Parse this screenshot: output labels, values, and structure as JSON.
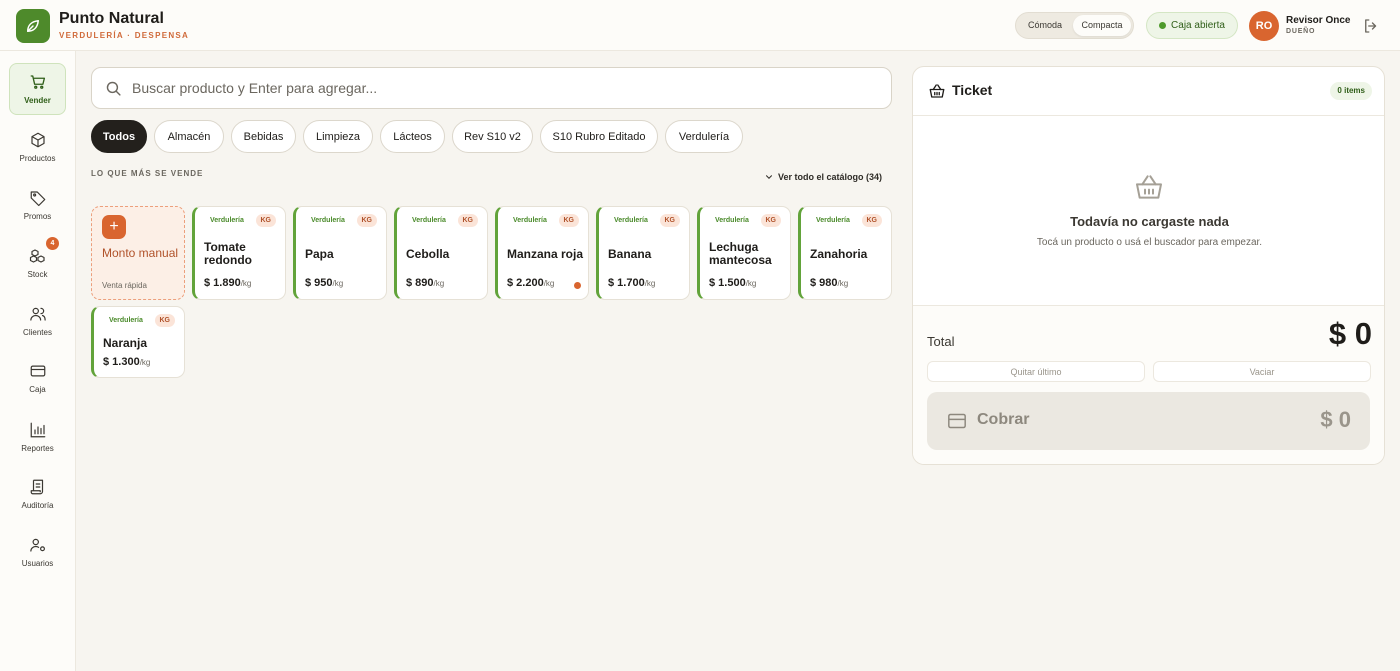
{
  "brand": {
    "name": "Punto Natural",
    "subtitle": "VERDULERÍA · DESPENSA"
  },
  "header": {
    "density": {
      "options": [
        "Cómoda",
        "Compacta"
      ],
      "selected": "Compacta"
    },
    "cash_status": "Caja abierta",
    "user": {
      "initials": "RO",
      "name": "Revisor Once",
      "role": "DUEÑO"
    }
  },
  "sidebar": {
    "items": [
      {
        "label": "Vender",
        "icon": "cart-icon",
        "active": true
      },
      {
        "label": "Productos",
        "icon": "box-icon"
      },
      {
        "label": "Promos",
        "icon": "tag-icon"
      },
      {
        "label": "Stock",
        "icon": "boxes-icon",
        "badge": "4"
      },
      {
        "label": "Clientes",
        "icon": "users-icon"
      },
      {
        "label": "Caja",
        "icon": "card-icon"
      },
      {
        "label": "Reportes",
        "icon": "bar-chart-icon"
      },
      {
        "label": "Auditoría",
        "icon": "scroll-icon"
      },
      {
        "label": "Usuarios",
        "icon": "user-cog-icon"
      }
    ]
  },
  "search": {
    "placeholder": "Buscar producto y Enter para agregar..."
  },
  "categories": [
    "Todos",
    "Almacén",
    "Bebidas",
    "Limpieza",
    "Lácteos",
    "Rev S10 v2",
    "S10 Rubro Editado",
    "Verdulería"
  ],
  "active_category": "Todos",
  "section": {
    "title": "LO QUE MÁS SE VENDE",
    "see_all": "Ver todo el catálogo (34)"
  },
  "manual_entry": {
    "title": "Monto manual",
    "subtitle": "Venta rápida",
    "icon": "plus-icon"
  },
  "products": [
    {
      "category": "Verdulería",
      "unit": "KG",
      "name": "Tomate redondo",
      "price": "$ 1.890",
      "per": "/kg"
    },
    {
      "category": "Verdulería",
      "unit": "KG",
      "name": "Papa",
      "price": "$ 950",
      "per": "/kg"
    },
    {
      "category": "Verdulería",
      "unit": "KG",
      "name": "Cebolla",
      "price": "$ 890",
      "per": "/kg"
    },
    {
      "category": "Verdulería",
      "unit": "KG",
      "name": "Manzana roja",
      "price": "$ 2.200",
      "per": "/kg",
      "low_stock": true
    },
    {
      "category": "Verdulería",
      "unit": "KG",
      "name": "Banana",
      "price": "$ 1.700",
      "per": "/kg"
    },
    {
      "category": "Verdulería",
      "unit": "KG",
      "name": "Lechuga mantecosa",
      "price": "$ 1.500",
      "per": "/kg"
    },
    {
      "category": "Verdulería",
      "unit": "KG",
      "name": "Zanahoria",
      "price": "$ 980",
      "per": "/kg"
    },
    {
      "category": "Verdulería",
      "unit": "KG",
      "name": "Naranja",
      "price": "$ 1.300",
      "per": "/kg"
    }
  ],
  "ticket": {
    "title": "Ticket",
    "count": "0 items",
    "empty_title": "Todavía no cargaste nada",
    "empty_subtitle": "Tocá un producto o usá el buscador para empezar.",
    "total_label": "Total",
    "total_value": "$ 0",
    "remove_last": "Quitar último",
    "clear": "Vaciar",
    "charge_label": "Cobrar",
    "charge_amount": "$ 0"
  },
  "colors": {
    "brand_green": "#4e8a2b",
    "accent_orange": "#d9652f",
    "dark": "#23201c"
  }
}
